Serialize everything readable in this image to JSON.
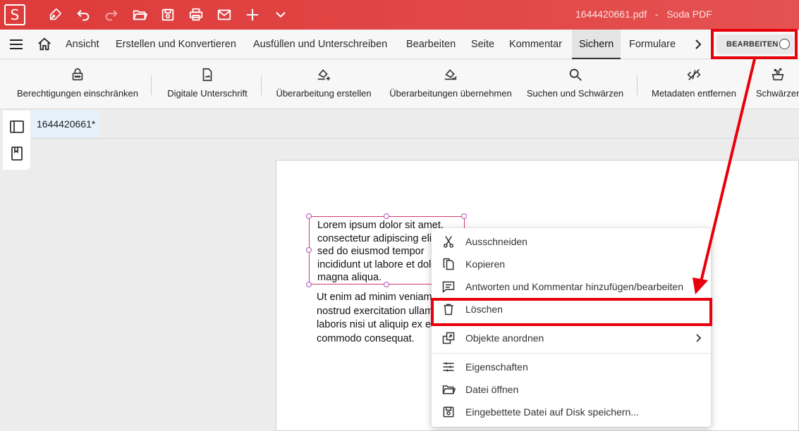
{
  "titlebar": {
    "logo": "S",
    "title": "1644420661.pdf   -   Soda PDF",
    "icons": [
      "pen-icon",
      "undo-icon",
      "redo-icon",
      "open-folder-icon",
      "save-icon",
      "print-icon",
      "mail-icon",
      "plus-icon",
      "chevron-down-icon"
    ],
    "bg_color": "#e24747"
  },
  "menubar": {
    "tabs": [
      {
        "label": "Ansicht"
      },
      {
        "label": "Erstellen und Konvertieren"
      },
      {
        "label": "Ausfüllen und Unterschreiben"
      },
      {
        "label": "Bearbeiten"
      },
      {
        "label": "Seite"
      },
      {
        "label": "Kommentar"
      },
      {
        "label": "Sichern",
        "active": true
      },
      {
        "label": "Formulare"
      }
    ],
    "edit_toggle_label": "BEARBEITEN"
  },
  "ribbon": {
    "buttons": [
      {
        "label": "Berechtigungen einschränken",
        "icon": "lock-icon"
      },
      {
        "label": "Digitale Unterschrift",
        "icon": "signature-file-icon"
      },
      {
        "label": "Überarbeitung erstellen",
        "icon": "redaction-add-icon"
      },
      {
        "label": "Überarbeitungen übernehmen",
        "icon": "redaction-apply-icon"
      },
      {
        "label": "Suchen und Schwärzen",
        "icon": "search-icon"
      },
      {
        "label": "Metadaten entfernen",
        "icon": "metadata-remove-icon"
      },
      {
        "label": "Schwärzen",
        "icon": "sanitize-icon"
      }
    ]
  },
  "document": {
    "tab_label": "1644420661*",
    "text_selected": "Lorem ipsum dolor sit amet,\nconsectetur adipiscing elit,\nsed do eiusmod tempor\nincididunt ut labore et dolore\nmagna aliqua.",
    "text_body": "Ut enim ad minim veniam,\nnostrud exercitation ullamco\nlaboris nisi ut aliquip ex ea\ncommodo consequat."
  },
  "context_menu": {
    "items": [
      {
        "label": "Ausschneiden",
        "icon": "scissors-icon"
      },
      {
        "label": "Kopieren",
        "icon": "copy-icon"
      },
      {
        "label": "Antworten und Kommentar hinzufügen/bearbeiten",
        "icon": "comment-icon"
      },
      {
        "label": "Löschen",
        "icon": "trash-icon"
      },
      {
        "label": "Objekte anordnen",
        "icon": "arrange-icon",
        "submenu": true
      },
      {
        "label": "Eigenschaften",
        "icon": "sliders-icon"
      },
      {
        "label": "Datei öffnen",
        "icon": "folder-open-icon"
      },
      {
        "label": "Eingebettete Datei auf Disk speichern...",
        "icon": "save-disk-icon"
      }
    ]
  },
  "annotation_color": "#e8000a"
}
